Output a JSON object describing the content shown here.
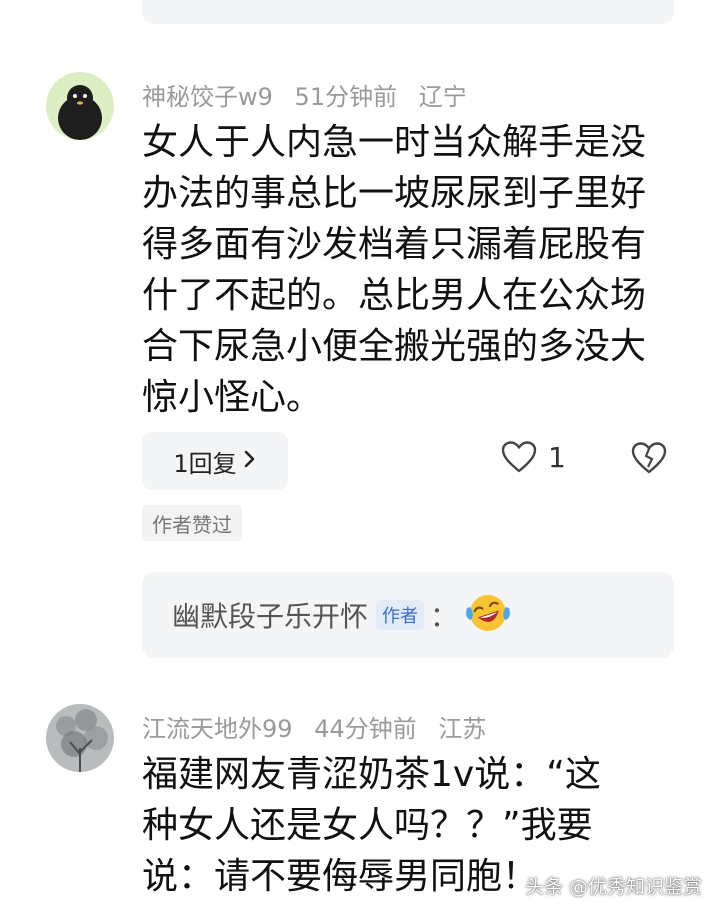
{
  "comments": [
    {
      "username": "神秘饺子w9",
      "time": "51分钟前",
      "location": "辽宁",
      "lines": [
        "女人于人内急一时当众解手是没",
        "办法的事总比一坡尿尿到子里好",
        "得多面有沙发档着只漏着屁股有",
        "什了不起的。总比男人在公众场",
        "合下尿急小便全搬光强的多没大",
        "惊小怪心。"
      ],
      "reply_button": "1回复",
      "like_count": "1",
      "author_liked": "作者赞过",
      "author_reply": {
        "name": "幽默段子乐开怀",
        "tag": "作者",
        "colon": "："
      }
    },
    {
      "username": "江流天地外99",
      "time": "44分钟前",
      "location": "江苏",
      "lines": [
        "福建网友青涩奶茶1v说：“这",
        "种女人还是女人吗？？”我要",
        "说：请不要侮辱男同胞！"
      ]
    }
  ],
  "watermark": "头条 @优秀知识鉴赏",
  "icons": {
    "chevron": "chevron-right-icon",
    "like": "heart-outline-icon",
    "dislike": "broken-heart-icon",
    "emoji": "laughing-crying-emoji-icon"
  }
}
